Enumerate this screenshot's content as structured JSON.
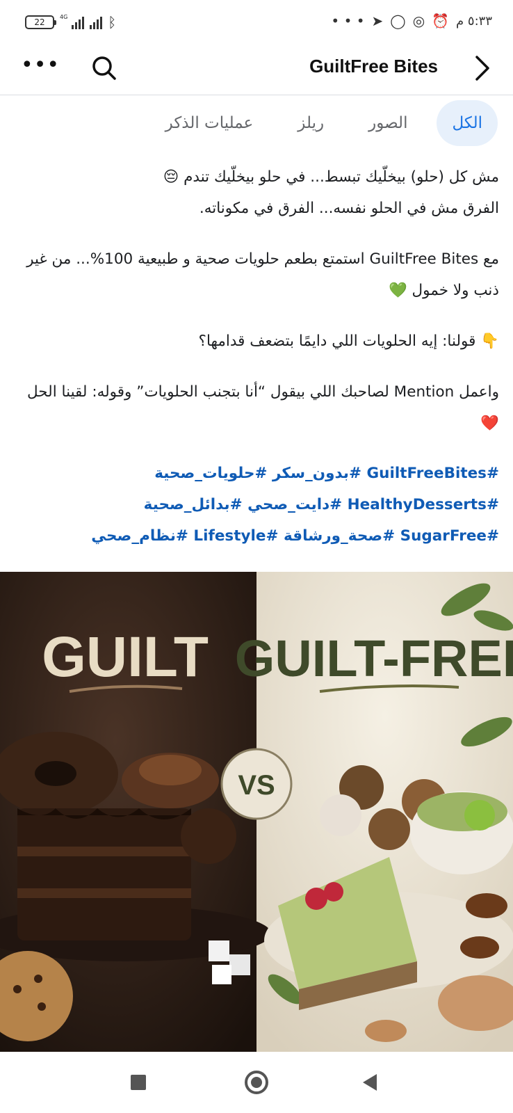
{
  "status_bar": {
    "time": "٥:٣٣ م",
    "battery": "22",
    "network": "4G"
  },
  "header": {
    "title": "GuiltFree Bites",
    "icons": [
      "more-icon",
      "search-icon",
      "chevron-right-icon"
    ]
  },
  "tabs": [
    {
      "label": "الكل",
      "active": true
    },
    {
      "label": "الصور",
      "active": false
    },
    {
      "label": "ريلز",
      "active": false
    },
    {
      "label": "عمليات الذكر",
      "active": false
    }
  ],
  "post": {
    "paragraphs": [
      [
        "مش كل (حلو) بيخلّيك تبسط... في حلو بيخلّيك تندم 😔",
        "الفرق مش في الحلو نفسه... الفرق في مكوناته."
      ],
      [
        "مع GuiltFree Bites استمتع بطعم حلويات صحية و طبيعية 100%... من غير ذنب ولا خمول 💚"
      ],
      [
        "👇 قولنا: إيه الحلويات اللي دايمًا بتضعف قدامها؟"
      ],
      [
        "واعمل Mention لصاحبك اللي بيقول “أنا بتجنب الحلويات” وقوله: لقينا الحل ❤️"
      ]
    ],
    "hashtag_lines": [
      "#GuiltFreeBites #بدون_سكر #حلويات_صحية",
      "#HealthyDesserts #دايت_صحي #بدائل_صحية",
      "#SugarFree #صحة_ورشاقة #Lifestyle #نظام_صحي"
    ]
  },
  "image": {
    "left_title": "GUILT",
    "right_title": "GUILT-FREE",
    "badge": "VS",
    "colors": {
      "left_bg": "#2b1d16",
      "right_bg": "#ece5d6",
      "left_text": "#e8dcc4",
      "right_text": "#3f4a2a"
    }
  },
  "nav_bar": {
    "icons": [
      "recents-icon",
      "home-icon",
      "back-icon"
    ]
  },
  "colors": {
    "accent": "#1b74e4",
    "hashtag": "#0f5bb5",
    "tab_active_bg": "#e7f0fb"
  }
}
